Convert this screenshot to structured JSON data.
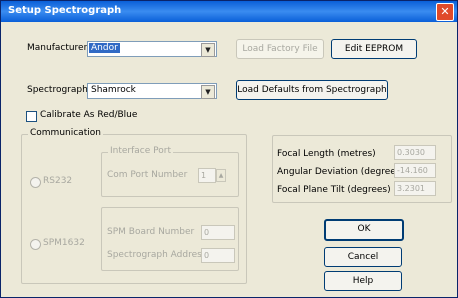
{
  "window": {
    "title": "Setup Spectrograph"
  },
  "manufacturer": {
    "label": "Manufacturer:",
    "value": "Andor"
  },
  "spectrograph": {
    "label": "Spectrograph:",
    "value": "Shamrock"
  },
  "buttons": {
    "load_factory": "Load Factory File",
    "edit_eeprom": "Edit EEPROM",
    "load_defaults": "Load Defaults from Spectrograph",
    "ok": "OK",
    "cancel": "Cancel",
    "help": "Help"
  },
  "calibrate": {
    "label": "Calibrate As Red/Blue",
    "checked": false
  },
  "communication": {
    "title": "Communication",
    "rs232": "RS232",
    "interface_port": "Interface Port",
    "com_port_label": "Com Port Number",
    "com_port_value": "1",
    "spm_label": "SPM1632",
    "spm_board_label": "SPM Board Number",
    "spm_board_value": "0",
    "spec_address_label": "Spectrograph Address",
    "spec_address_value": "0"
  },
  "optics": {
    "focal_length_label": "Focal Length (metres)",
    "focal_length_value": "0.3030",
    "angular_dev_label": "Angular Deviation (degrees)",
    "angular_dev_value": "-14.160",
    "focal_tilt_label": "Focal Plane Tilt (degrees)",
    "focal_tilt_value": "3.2301"
  },
  "icons": {
    "close": "close-icon",
    "dropdown": "chevron-down-icon",
    "spin": "spin-arrows-icon"
  }
}
